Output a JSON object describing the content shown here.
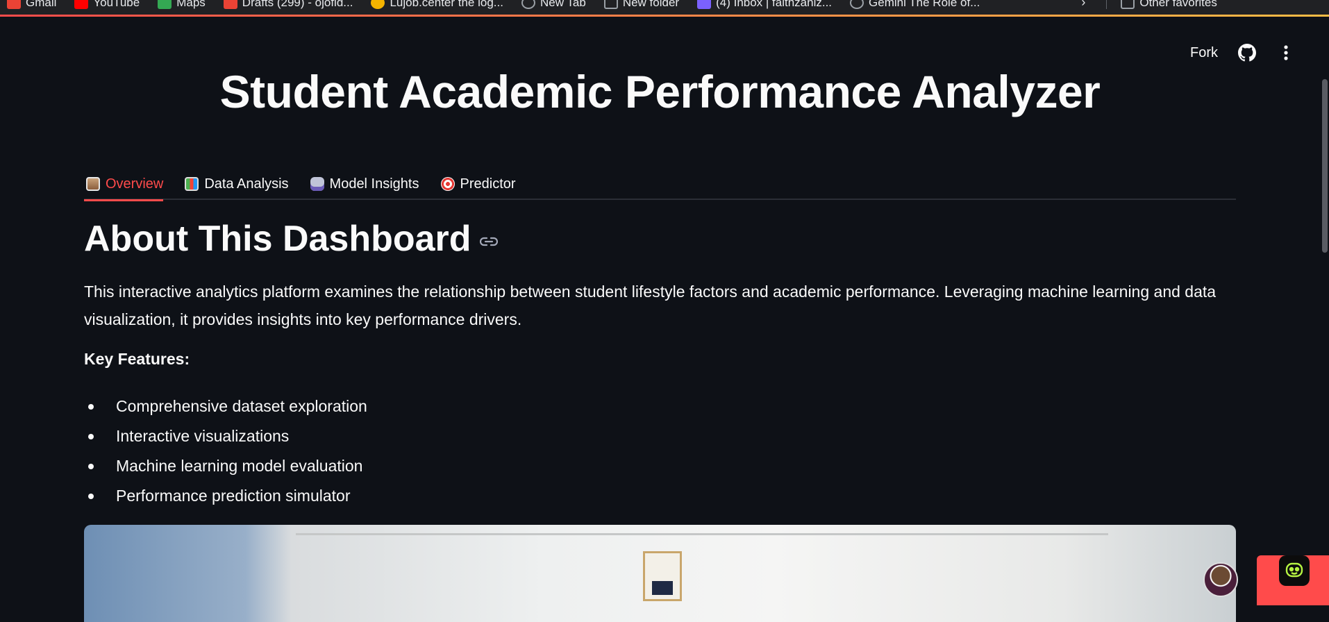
{
  "bookmarks": [
    {
      "label": "Gmail",
      "icon": "gmail-icon",
      "color": "#ea4335"
    },
    {
      "label": "YouTube",
      "icon": "youtube-icon",
      "color": "#ff0000"
    },
    {
      "label": "Maps",
      "icon": "maps-icon",
      "color": "#34a853"
    },
    {
      "label": "Drafts (299) - ojofid...",
      "icon": "gmail-icon",
      "color": "#ea4335"
    },
    {
      "label": "Lujob.center the log...",
      "icon": "site-icon",
      "color": "#f5b400"
    },
    {
      "label": "New Tab",
      "icon": "globe-icon",
      "color": "#9aa0a6"
    },
    {
      "label": "New folder",
      "icon": "folder-icon",
      "color": "#9aa0a6"
    },
    {
      "label": "(4) Inbox | faithzaniz...",
      "icon": "inbox-icon",
      "color": "#7b61ff"
    },
    {
      "label": "Gemini The Role of...",
      "icon": "globe-icon",
      "color": "#9aa0a6"
    }
  ],
  "other_favorites": "Other favorites",
  "toolbar": {
    "fork_label": "Fork"
  },
  "app": {
    "title": "Student Academic Performance Analyzer",
    "tabs": [
      {
        "label": "Overview",
        "icon": "clipboard-icon",
        "active": true
      },
      {
        "label": "Data Analysis",
        "icon": "bar-chart-icon",
        "active": false
      },
      {
        "label": "Model Insights",
        "icon": "robot-icon",
        "active": false
      },
      {
        "label": "Predictor",
        "icon": "target-icon",
        "active": false
      }
    ],
    "section_title": "About This Dashboard",
    "description": "This interactive analytics platform examines the relationship between student lifestyle factors and academic performance. Leveraging machine learning and data visualization, it provides insights into key performance drivers.",
    "key_features_label": "Key Features:",
    "features": [
      "Comprehensive dataset exploration",
      "Interactive visualizations",
      "Machine learning model evaluation",
      "Performance prediction simulator"
    ]
  },
  "colors": {
    "background": "#0e1117",
    "accent": "#ff4b4b",
    "text": "#fafafa"
  }
}
